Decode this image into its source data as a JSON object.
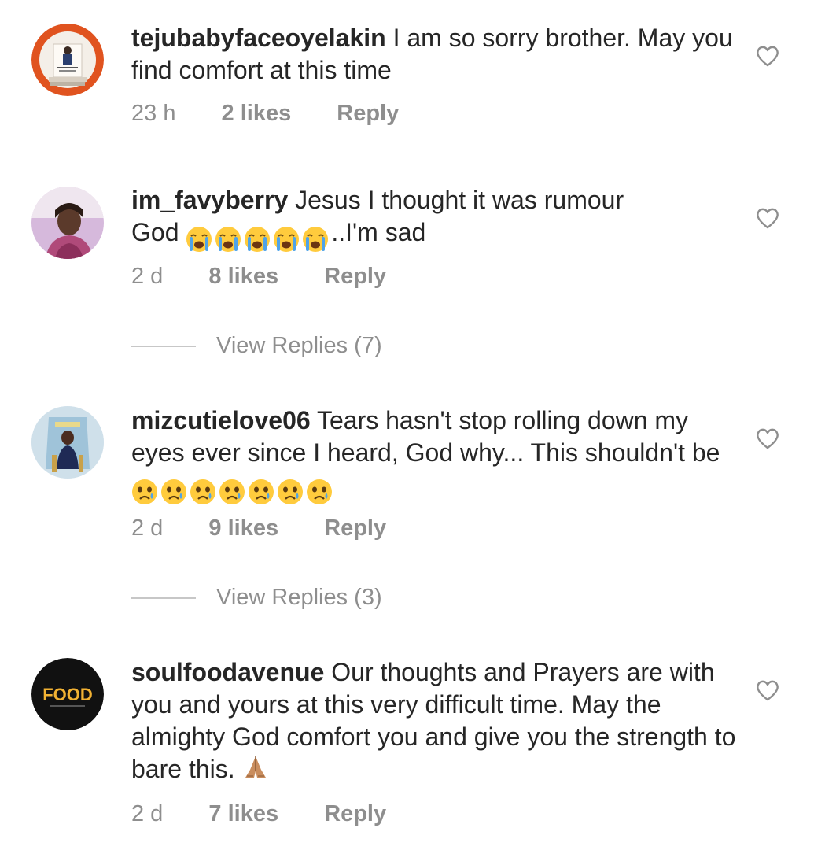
{
  "comments": [
    {
      "username": "tejubabyfaceoyelakin",
      "text": "I am so sorry brother. May you find comfort at this time",
      "time": "23 h",
      "likes": "2 likes",
      "reply": "Reply"
    },
    {
      "username": "im_favyberry",
      "text_line1": "Jesus I thought it was rumour",
      "text_pre": "God",
      "text_post": "..I'm sad",
      "emoji": "loudly-crying-face",
      "emoji_count": 5,
      "time": "2 d",
      "likes": "8 likes",
      "reply": "Reply",
      "view_replies": "View Replies (7)"
    },
    {
      "username": "mizcutielove06",
      "text": "Tears hasn't stop rolling down my eyes ever since I heard,  God  why... This shouldn't be",
      "emoji": "crying-face",
      "emoji_count": 7,
      "time": "2 d",
      "likes": "9 likes",
      "reply": "Reply",
      "view_replies": "View Replies (3)"
    },
    {
      "username": "soulfoodavenue",
      "text": "Our thoughts and Prayers are with you and yours at this very difficult time. May the almighty God comfort you and give you the strength to bare this.",
      "emoji": "folded-hands",
      "time": "2 d",
      "likes": "7 likes",
      "reply": "Reply",
      "avatar_logo_text": "FOOD"
    }
  ],
  "icons": {
    "like": "heart-outline-icon"
  },
  "colors": {
    "text": "#262626",
    "meta": "#8e8e8e",
    "divider": "#c7c7c7"
  }
}
